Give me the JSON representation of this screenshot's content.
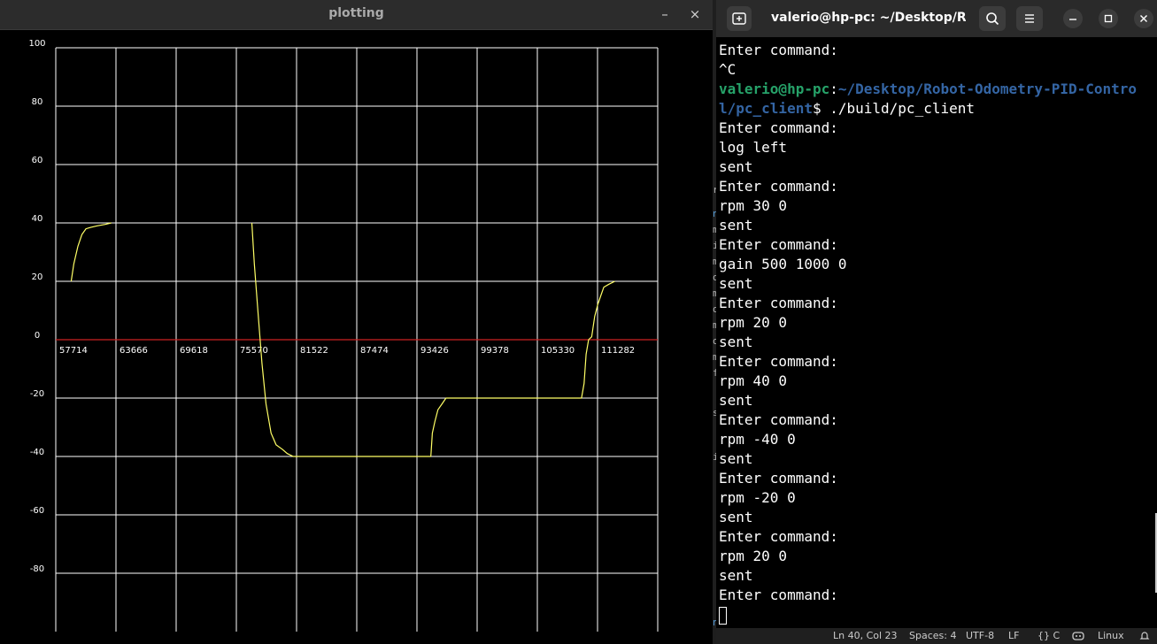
{
  "plot_window": {
    "title": "plotting",
    "minimize_label": "–",
    "close_label": "×"
  },
  "chart_data": {
    "type": "line",
    "ylim": [
      -100,
      100
    ],
    "yticks": [
      100,
      80,
      60,
      40,
      20,
      0,
      -20,
      -40,
      -60,
      -80
    ],
    "xticks": [
      57714,
      63666,
      69618,
      75570,
      81522,
      87474,
      93426,
      99378,
      105330,
      111282
    ],
    "xlim": [
      57714,
      117234
    ],
    "grid": true,
    "zero_line_color": "#cc2222",
    "series_color": "#ffff66",
    "series": [
      {
        "x": [
          59234,
          59500,
          59900,
          60300,
          60700,
          61200,
          61800,
          62600,
          63200
        ],
        "y": [
          20,
          26,
          32,
          36,
          38,
          38.5,
          39,
          39.5,
          40
        ]
      },
      {
        "x": [
          77100,
          77350,
          77700,
          78100,
          78500,
          79000,
          79500,
          80100,
          80600,
          81200,
          81800
        ],
        "y": [
          40,
          26,
          10,
          -8,
          -22,
          -32,
          -36,
          -37.5,
          -39,
          -40,
          -40
        ]
      },
      {
        "x": [
          81800,
          94800
        ],
        "y": [
          -40,
          -40
        ]
      },
      {
        "x": [
          94800,
          94950,
          95200,
          95500,
          95900,
          96300
        ],
        "y": [
          -40,
          -32,
          -28,
          -24,
          -22,
          -20
        ]
      },
      {
        "x": [
          96300,
          109700
        ],
        "y": [
          -20,
          -20
        ]
      },
      {
        "x": [
          109700,
          109950,
          110150,
          110400,
          110700,
          111000,
          111300,
          111600,
          111900,
          112400,
          113000
        ],
        "y": [
          -20,
          -15,
          -5,
          0,
          1,
          8,
          12,
          15,
          18,
          19,
          20
        ]
      }
    ]
  },
  "editor_strip": {
    "glyphs": [
      "r",
      "n",
      "m",
      "i",
      "m",
      "o",
      "m",
      "o",
      "m",
      "o",
      "m",
      "f",
      "s",
      "i",
      "n"
    ]
  },
  "terminal": {
    "title": "valerio@hp-pc: ~/Desktop/R...",
    "prompt_user": "valerio@hp-pc",
    "prompt_path": "~/Desktop/Robot-Odometry-PID-Contro",
    "prompt_path_cont": "l/pc_client",
    "prompt_cmd": "$ ./build/pc_client",
    "lines_before": [
      "Enter command:",
      "^C"
    ],
    "lines_after": [
      "Enter command:",
      "log left",
      "sent",
      "Enter command:",
      "rpm 30 0",
      "sent",
      "Enter command:",
      "gain 500 1000 0",
      "sent",
      "Enter command:",
      "rpm 20 0",
      "sent",
      "Enter command:",
      "rpm 40 0",
      "sent",
      "Enter command:",
      "rpm -40 0",
      "sent",
      "Enter command:",
      "rpm -20 0",
      "sent",
      "Enter command:",
      "rpm 20 0",
      "sent",
      "Enter command:"
    ]
  },
  "status_bar": {
    "position": "Ln 40, Col 23",
    "spaces": "Spaces: 4",
    "encoding": "UTF-8",
    "eol": "LF",
    "language": "{} C",
    "os": "Linux"
  }
}
